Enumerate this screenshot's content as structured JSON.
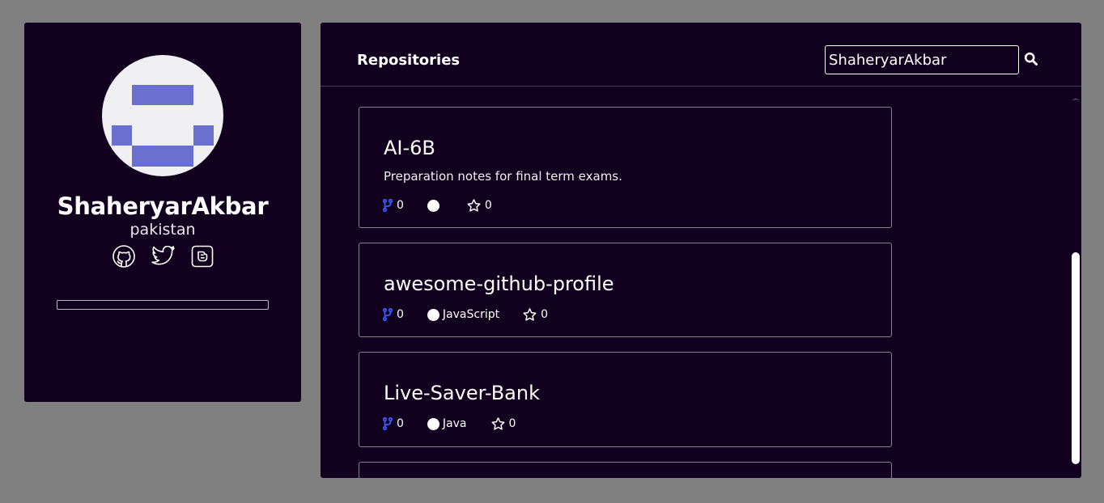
{
  "profile": {
    "name": "ShaheryarAkbar",
    "location": "pakistan",
    "social_icons": [
      "github-icon",
      "twitter-icon",
      "blogger-icon"
    ]
  },
  "repos": {
    "title": "Repositories",
    "search": {
      "value": "ShaheryarAkbar",
      "icon": "search-icon"
    },
    "items": [
      {
        "name": "AI-6B",
        "description": "Preparation notes for final term exams.",
        "forks": "0",
        "language": "",
        "stars": "0"
      },
      {
        "name": "awesome-github-profile",
        "description": "",
        "forks": "0",
        "language": "JavaScript",
        "stars": "0"
      },
      {
        "name": "Live-Saver-Bank",
        "description": "",
        "forks": "0",
        "language": "Java",
        "stars": "0"
      }
    ]
  },
  "colors": {
    "page_bg": "#808080",
    "card_bg": "#12001f",
    "avatar_accent": "#6b6fcf",
    "fork_icon": "#3b5bff",
    "text": "#ffffff"
  }
}
